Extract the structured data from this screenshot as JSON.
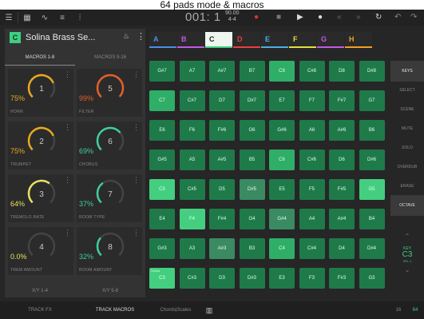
{
  "caption": "64 pads mode & macros",
  "topbar": {
    "menu_icon": "hamburger-icon",
    "position": "001: 1",
    "tempo": "90.00",
    "signature": "4-4"
  },
  "device": {
    "badge": "C",
    "name": "Solina Brass Se...",
    "tabs": [
      "MACROS 1-8",
      "MACROS 9-16"
    ],
    "macros": [
      {
        "num": "1",
        "value": "75%",
        "label": "HORN",
        "color": "#e8a820",
        "level": 0.75
      },
      {
        "num": "5",
        "value": "99%",
        "label": "FILTER",
        "color": "#e0602a",
        "level": 0.99
      },
      {
        "num": "2",
        "value": "75%",
        "label": "TRUMPET",
        "color": "#e8a820",
        "level": 0.75
      },
      {
        "num": "6",
        "value": "69%",
        "label": "CHORUS",
        "color": "#3ecf9a",
        "level": 0.69
      },
      {
        "num": "3",
        "value": "64%",
        "label": "TREMOLO RATE",
        "color": "#e8e060",
        "level": 0.64
      },
      {
        "num": "7",
        "value": "37%",
        "label": "ROOM TYPE",
        "color": "#3ecf9a",
        "level": 0.37
      },
      {
        "num": "4",
        "value": "0.0%",
        "label": "TREM AMOUNT",
        "color": "#e8e060",
        "level": 0.0
      },
      {
        "num": "8",
        "value": "32%",
        "label": "ROOM AMOUNT",
        "color": "#3ecf9a",
        "level": 0.32
      }
    ],
    "xy_tabs": [
      "X/Y 1-4",
      "X/Y 5-8"
    ]
  },
  "tracks": [
    {
      "letter": "A",
      "color": "#4a8ee8"
    },
    {
      "letter": "B",
      "color": "#c05ae0"
    },
    {
      "letter": "C",
      "color": "#3ecf83"
    },
    {
      "letter": "D",
      "color": "#e84040"
    },
    {
      "letter": "E",
      "color": "#4ab0e0"
    },
    {
      "letter": "F",
      "color": "#e0e040"
    },
    {
      "letter": "G",
      "color": "#c05ae0"
    },
    {
      "letter": "H",
      "color": "#f0a020"
    }
  ],
  "pads": [
    [
      "G#7",
      "A7",
      "A#7",
      "B7",
      "C8",
      "C#8",
      "D8",
      "D#8"
    ],
    [
      "C7",
      "C#7",
      "D7",
      "D#7",
      "E7",
      "F7",
      "F#7",
      "G7"
    ],
    [
      "E6",
      "F6",
      "F#6",
      "G6",
      "G#6",
      "A6",
      "A#6",
      "B6"
    ],
    [
      "G#5",
      "A5",
      "A#5",
      "B5",
      "C6",
      "C#6",
      "D6",
      "D#6"
    ],
    [
      "C5",
      "C#5",
      "D5",
      "D#5",
      "E5",
      "F5",
      "F#5",
      "G5"
    ],
    [
      "E4",
      "F4",
      "F#4",
      "G4",
      "G#4",
      "A4",
      "A#4",
      "B4"
    ],
    [
      "G#3",
      "A3",
      "A#3",
      "B3",
      "C4",
      "C#4",
      "D4",
      "D#4"
    ],
    [
      "C3",
      "C#3",
      "D3",
      "D#3",
      "E3",
      "F3",
      "F#3",
      "G3"
    ]
  ],
  "pad_corner_label": "Solina",
  "sidebar": [
    "KEYS",
    "SELECT",
    "SCENE",
    "MUTE",
    "SOLO",
    "OVERDUB",
    "ERASE",
    "OCTAVE"
  ],
  "key_info": {
    "label": "KEY",
    "value": "C3",
    "sub": "VEL 1"
  },
  "bottom": {
    "tabs": [
      "TRACK FX",
      "TRACK MACROS",
      "Chords|Scales"
    ],
    "left_num": "16",
    "right_num": "64"
  }
}
